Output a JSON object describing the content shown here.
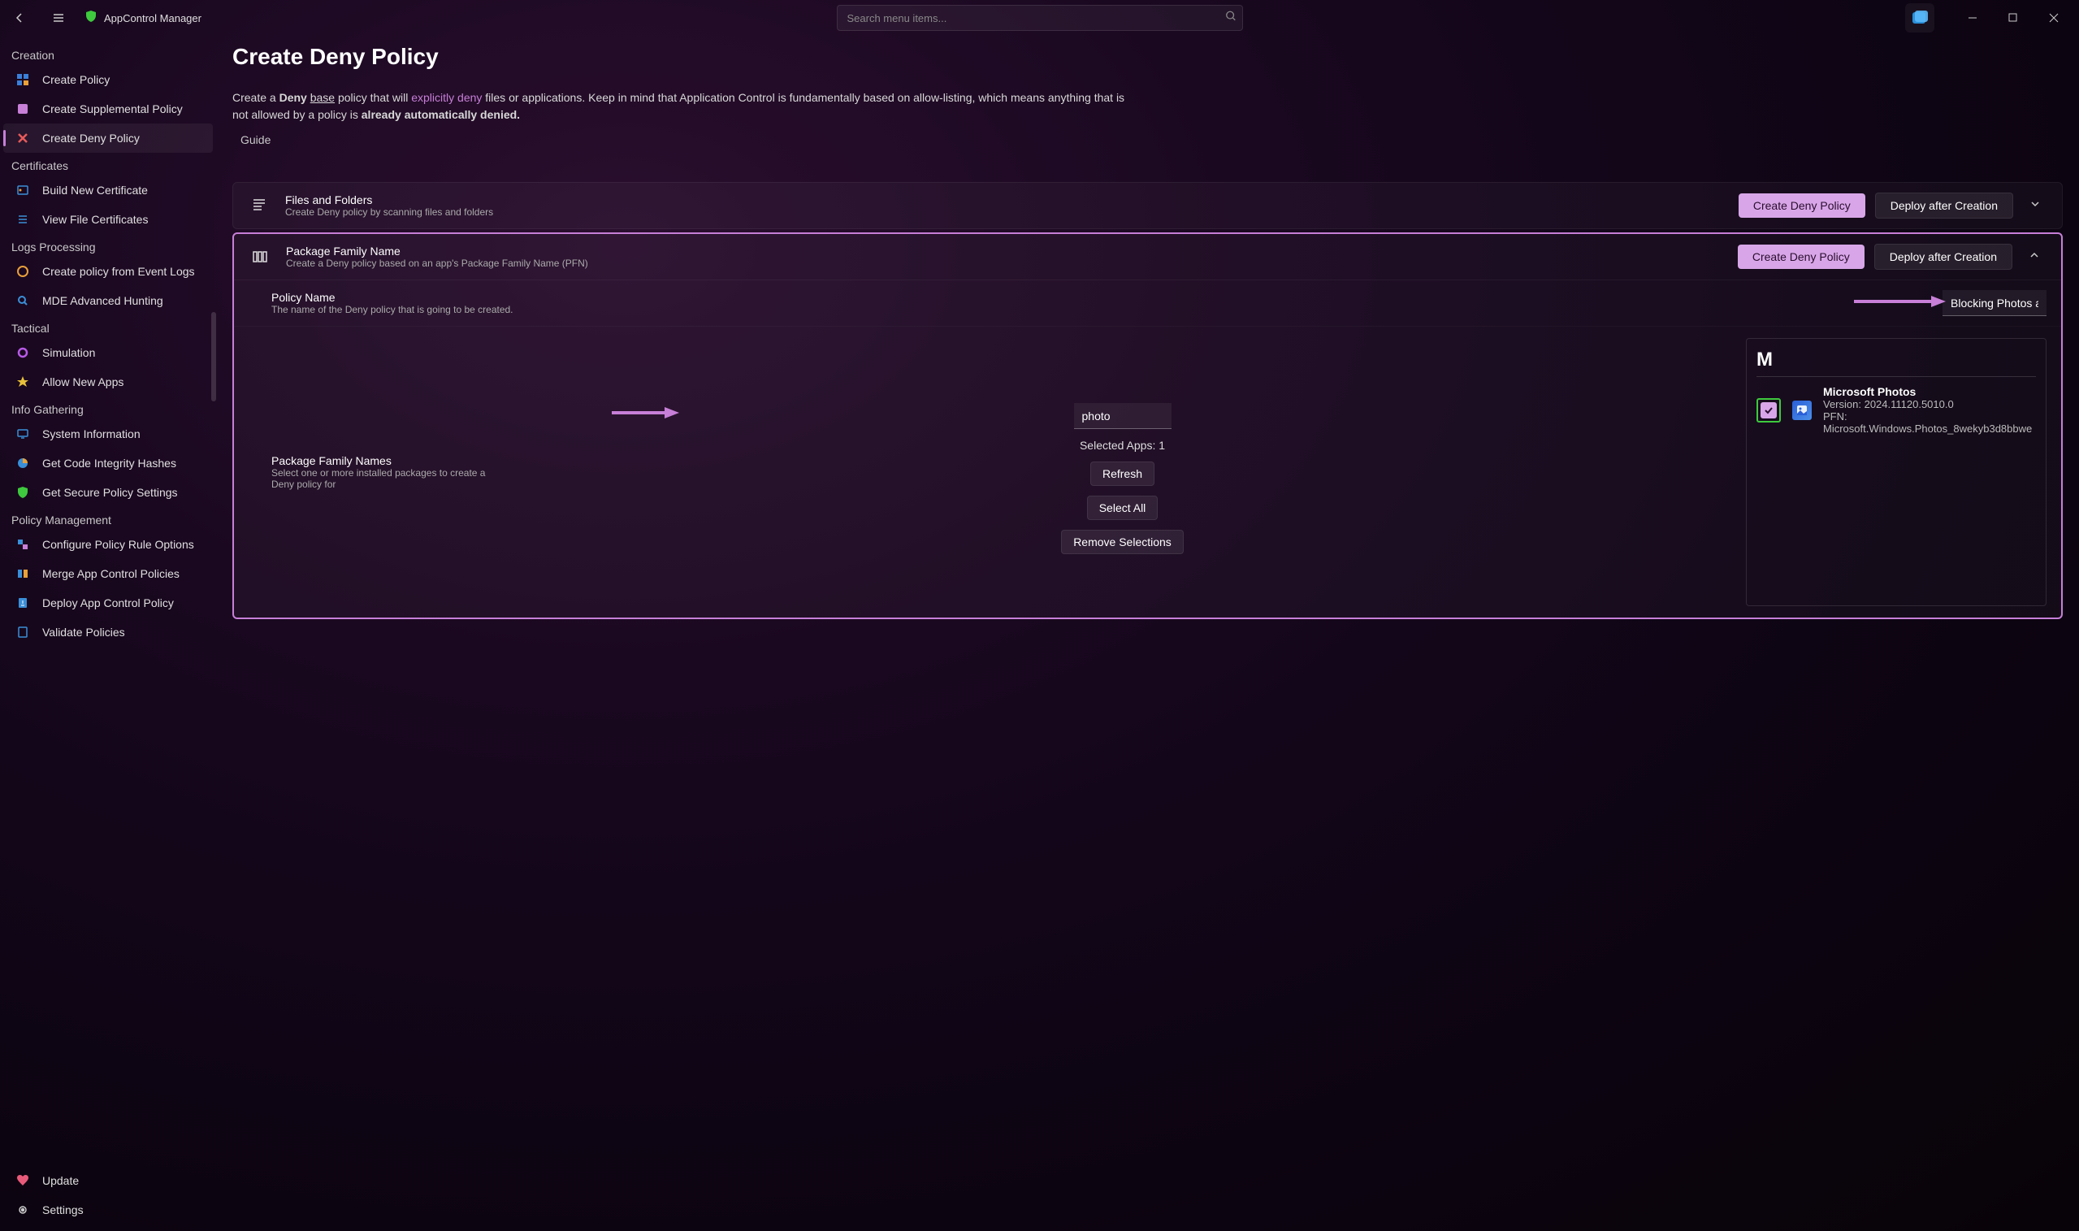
{
  "app": {
    "title": "AppControl Manager"
  },
  "search": {
    "placeholder": "Search menu items..."
  },
  "sidebar": {
    "sections": {
      "creation": "Creation",
      "certificates": "Certificates",
      "logs": "Logs Processing",
      "tactical": "Tactical",
      "info": "Info Gathering",
      "policy_mgmt": "Policy Management"
    },
    "items": {
      "create_policy": "Create Policy",
      "create_supplemental": "Create Supplemental Policy",
      "create_deny": "Create Deny Policy",
      "build_cert": "Build New Certificate",
      "view_certs": "View File Certificates",
      "event_logs": "Create policy from Event Logs",
      "mde_hunting": "MDE Advanced Hunting",
      "simulation": "Simulation",
      "allow_new": "Allow New Apps",
      "sys_info": "System Information",
      "code_integrity": "Get Code Integrity Hashes",
      "secure_policy": "Get Secure Policy Settings",
      "rule_options": "Configure Policy Rule Options",
      "merge": "Merge App Control Policies",
      "deploy": "Deploy App Control Policy",
      "validate": "Validate Policies",
      "update": "Update",
      "settings": "Settings"
    }
  },
  "page": {
    "title": "Create Deny Policy",
    "desc_prefix": "Create a ",
    "desc_bold1": "Deny",
    "desc_base": "base",
    "desc_mid": " policy that will ",
    "desc_link": "explicitly deny",
    "desc_suffix": " files or applications. Keep in mind that Application Control is fundamentally based on allow-listing, which means anything that is not allowed by a policy is ",
    "desc_bold2": "already automatically denied.",
    "guide": "Guide"
  },
  "expanders": {
    "files": {
      "title": "Files and Folders",
      "subtitle": "Create Deny policy by scanning files and folders",
      "btn_create": "Create Deny Policy",
      "btn_deploy": "Deploy after Creation"
    },
    "pfn": {
      "title": "Package Family Name",
      "subtitle": "Create a Deny policy based on an app's Package Family Name (PFN)",
      "btn_create": "Create Deny Policy",
      "btn_deploy": "Deploy after Creation",
      "policy_name": {
        "title": "Policy Name",
        "subtitle": "The name of the Deny policy that is going to be created.",
        "value": "Blocking Photos app"
      },
      "pfn_names": {
        "title": "Package Family Names",
        "subtitle": "Select one or more installed packages to create a Deny policy for"
      },
      "filter_value": "photo",
      "selected_text": "Selected Apps: 1",
      "btn_refresh": "Refresh",
      "btn_select_all": "Select All",
      "btn_remove": "Remove Selections",
      "group": "M",
      "app": {
        "name": "Microsoft Photos",
        "version": "Version: 2024.11120.5010.0",
        "pfn": "PFN: Microsoft.Windows.Photos_8wekyb3d8bbwe"
      }
    }
  }
}
